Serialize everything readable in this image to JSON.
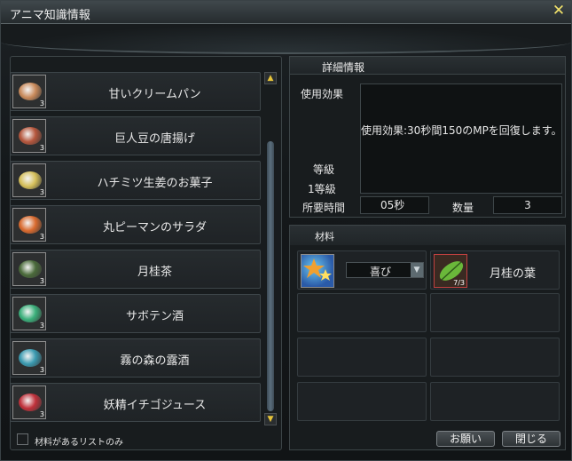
{
  "window": {
    "title": "アニマ知識情報",
    "close": "✕"
  },
  "list": {
    "items": [
      {
        "label": "甘いクリームパン",
        "count": "3",
        "icon": "bread-icon",
        "color": "#c98a5b"
      },
      {
        "label": "巨人豆の唐揚げ",
        "count": "3",
        "icon": "fried-beans-icon",
        "color": "#b5563c"
      },
      {
        "label": "ハチミツ生姜のお菓子",
        "count": "3",
        "icon": "honey-snack-icon",
        "color": "#d6c05a"
      },
      {
        "label": "丸ピーマンのサラダ",
        "count": "3",
        "icon": "salad-icon",
        "color": "#d96a2e"
      },
      {
        "label": "月桂茶",
        "count": "3",
        "icon": "tea-icon",
        "color": "#4a6a3a"
      },
      {
        "label": "サボテン酒",
        "count": "3",
        "icon": "cactus-liquor-icon",
        "color": "#3aaf7a"
      },
      {
        "label": "霧の森の露酒",
        "count": "3",
        "icon": "dew-liquor-icon",
        "color": "#3a9ab0"
      },
      {
        "label": "妖精イチゴジュース",
        "count": "3",
        "icon": "strawberry-juice-icon",
        "color": "#c0303a"
      }
    ],
    "checkbox_label": "材料があるリストのみ"
  },
  "detail": {
    "header": "詳細情報",
    "effect_label": "使用効果",
    "effect_text": "使用効果:30秒間150のMPを回復します。",
    "grade_label": "等級",
    "grade_value": "1等級",
    "time_label": "所要時間",
    "time_value": "05秒",
    "qty_label": "数量",
    "qty_value": "3"
  },
  "materials": {
    "header": "材料",
    "select_value": "喜び",
    "leaf_name": "月桂の葉",
    "leaf_count": "7/3"
  },
  "buttons": {
    "request": "お願い",
    "close": "閉じる"
  }
}
